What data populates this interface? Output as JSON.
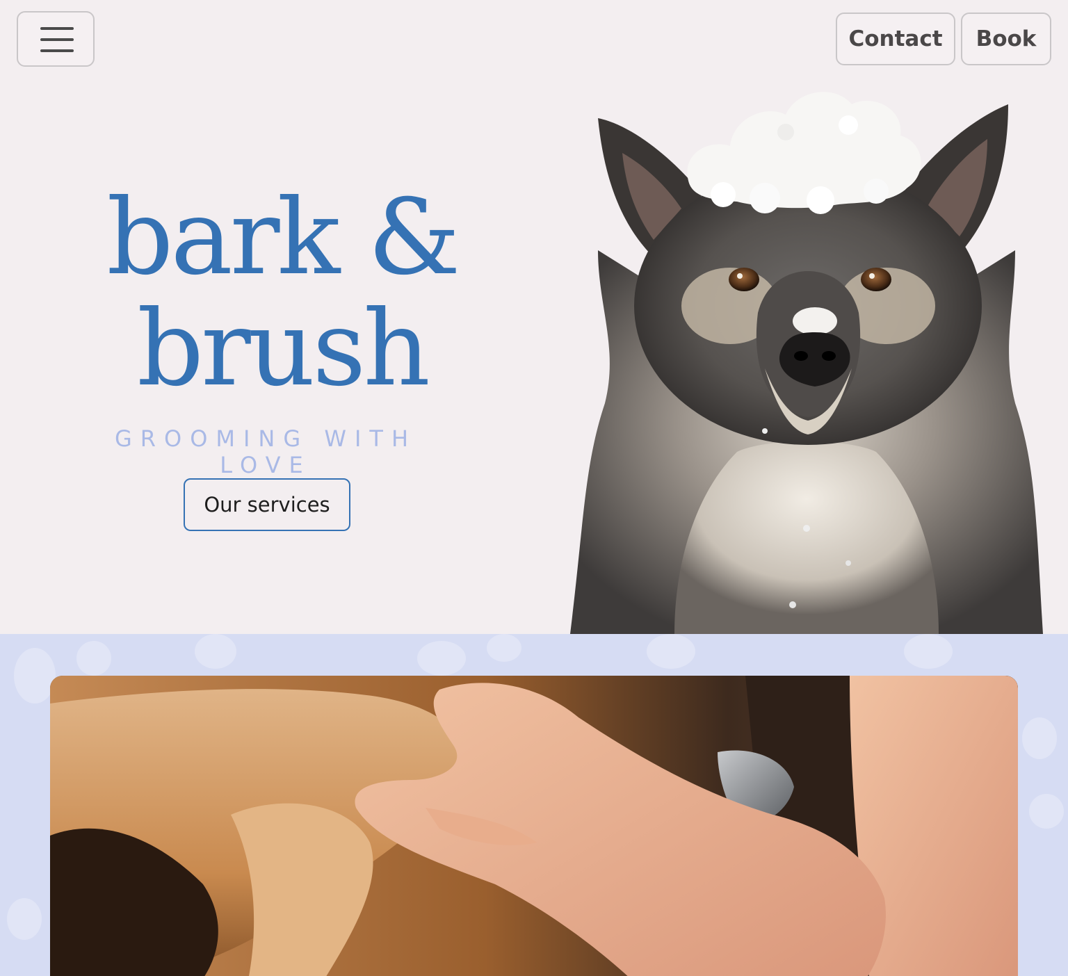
{
  "header": {
    "menu_icon": "hamburger-menu-icon",
    "contact_label": "Contact",
    "book_label": "Book"
  },
  "hero": {
    "title_line1": "bark &",
    "title_line2": "brush",
    "tagline": "GROOMING WITH LOVE",
    "cta_label": "Our services",
    "image_icon": "soapy-dog-photo"
  },
  "colors": {
    "page_background": "#f3eef0",
    "brand_blue": "#3572b4",
    "tagline_blue": "#a9b9e6",
    "section_background": "#d6dcf3",
    "button_border": "#c9c6c8"
  },
  "grooming_section": {
    "image_icon": "grooming-hands-photo",
    "pattern_icon": "paw-print-pattern"
  }
}
